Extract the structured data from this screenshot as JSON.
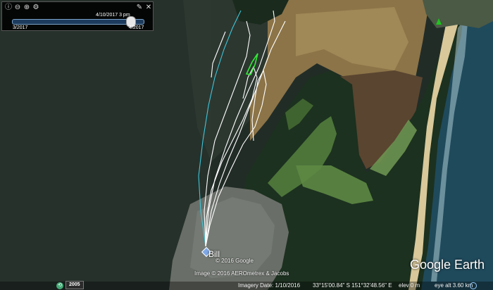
{
  "time_slider": {
    "current_label": "4/10/2017   3 pm",
    "start_label": "3/2017",
    "end_label": "4/2017",
    "tool_icons": [
      "info-icon",
      "zoom-out-icon",
      "zoom-in-icon",
      "settings-icon",
      "wrench-icon",
      "close-icon"
    ]
  },
  "map": {
    "place_label": "Bill",
    "copyright_lines": [
      "© 2016 Google",
      "Image © 2016 AEROmetrex & Jacobs"
    ],
    "brand": "Google Earth"
  },
  "status_bar": {
    "history_year": "2005",
    "imagery_date": "Imagery Date: 1/10/2016",
    "coordinates": "33°15'00.84\" S  151°32'48.56\" E",
    "elevation": "elev   0 m",
    "eye_alt": "eye alt   3.60 km"
  },
  "colors": {
    "water_deep": "#1f2b26",
    "water_shallow": "#6e7762",
    "sand": "#9c8354",
    "forest": "#1d3320",
    "fairway": "#4f7a3b",
    "ocean": "#20475a",
    "track_white": "#ffffff",
    "track_cyan": "#3ec6d8",
    "track_green": "#35e83a"
  }
}
